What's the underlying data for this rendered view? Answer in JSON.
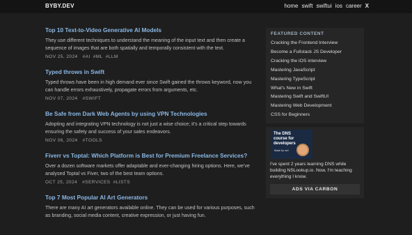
{
  "header": {
    "logo": "BYBY.DEV",
    "nav": [
      "home",
      "swift",
      "swiftui",
      "ios",
      "career"
    ],
    "x_label": "X"
  },
  "posts": [
    {
      "title": "Top 10 Text-to-Video Generative AI Models",
      "excerpt": "They use different techniques to understand the meaning of the input text and then create a sequence of images that are both spatially and temporally consistent with the text.",
      "date": "NOV 25, 2024",
      "tags": [
        "#AI",
        "#ML",
        "#LLM"
      ]
    },
    {
      "title": "Typed throws in Swift",
      "excerpt": "Typed throws have been in high demand ever since Swift gained the throws keyword, now you can handle errors exhaustively, propagate errors from arguments, etc.",
      "date": "NOV 07, 2024",
      "tags": [
        "#SWIFT"
      ]
    },
    {
      "title": "Be Safe from Dark Web Agents by using VPN Technologies",
      "excerpt": "Adopting and integrating VPN technology is not just a wise choice; it's a critical step towards ensuring the safety and success of your sales endeavors.",
      "date": "NOV 06, 2024",
      "tags": [
        "#TOOLS"
      ]
    },
    {
      "title": "Fiverr vs Toptal: Which Platform is Best for Premium Freelance Services?",
      "excerpt": "Over a dozen software markets offer adaptable and ever-changing hiring options. Here, we've analysed Toptal vs Fiver, two of the best team options.",
      "date": "OCT 25, 2024",
      "tags": [
        "#SERVICES",
        "#LISTS"
      ]
    },
    {
      "title": "Top 7 Most Popular AI Art Generators",
      "excerpt": "There are many AI art generators available online. They can be used for various purposes, such as branding, social media content, creative expression, or just having fun.",
      "date": "",
      "tags": []
    }
  ],
  "sidebar": {
    "featured_title": "FEATURED CONTENT",
    "featured": [
      "Cracking the Frontend Interview",
      "Become a Fullstack JS Developer",
      "Cracking the iOS interview",
      "Mastering JavaScript",
      "Mastering TypeScript",
      "What's New in Swift",
      "Mastering Swift and SwiftUI",
      "Mastering Web Development",
      "CSS for Beginners"
    ],
    "ad": {
      "image_title": "The DNS course for developers",
      "image_sub": "Made by me!",
      "text": "I've spent 2 years learning DNS while building NSLookup.io. Now, I'm teaching everything I know.",
      "button": "ADS VIA CARBON"
    }
  },
  "colors": {
    "background": "#1e1e1e",
    "topbar": "#141414",
    "link": "#8ab8e6",
    "panel": "#262626"
  }
}
